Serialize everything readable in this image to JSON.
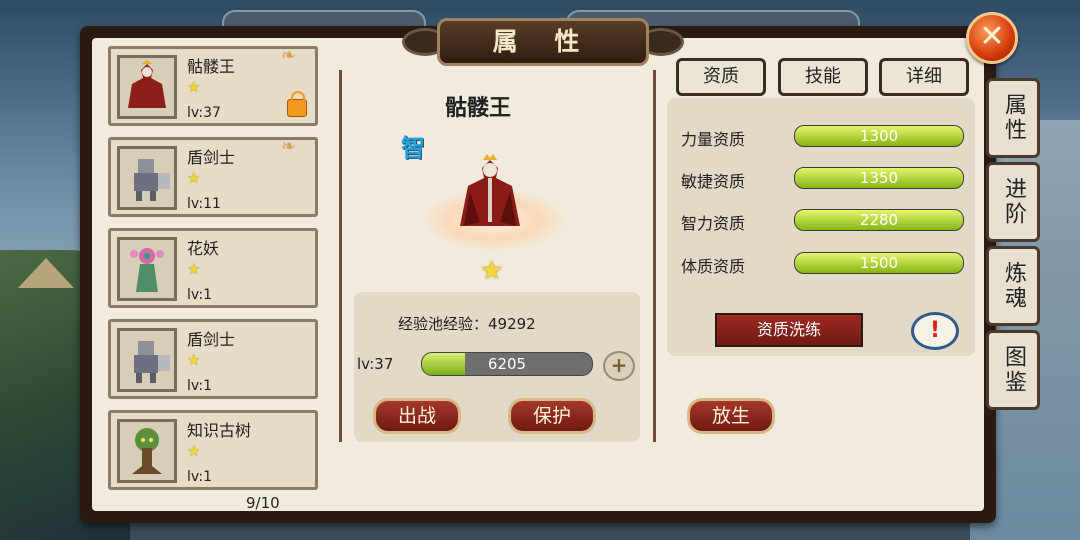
{
  "title": "属 性",
  "close_icon": "✕",
  "heroes": [
    {
      "name": "骷髅王",
      "level": "lv:37",
      "star": "★",
      "locked": true,
      "portrait": "skeleton-king"
    },
    {
      "name": "盾剑士",
      "level": "lv:11",
      "star": "★",
      "locked": false,
      "portrait": "shield-swordsman"
    },
    {
      "name": "花妖",
      "level": "lv:1",
      "star": "★",
      "locked": false,
      "portrait": "flower-demon"
    },
    {
      "name": "盾剑士",
      "level": "lv:1",
      "star": "★",
      "locked": false,
      "portrait": "shield-swordsman"
    },
    {
      "name": "知识古树",
      "level": "lv:1",
      "star": "★",
      "locked": false,
      "portrait": "knowledge-tree"
    }
  ],
  "pager": "9/10",
  "detail": {
    "name": "骷髅王",
    "attr_badge": "智",
    "star": "★",
    "exp_pool": "经验池经验：49292",
    "level": "lv:37",
    "exp_value": "6205",
    "exp_progress": 0.25,
    "plus": "+",
    "buttons": {
      "deploy": "出战",
      "protect": "保护",
      "release": "放生"
    }
  },
  "tabs": [
    "资质",
    "技能",
    "详细"
  ],
  "aptitudes": [
    {
      "label": "力量资质",
      "value": "1300"
    },
    {
      "label": "敏捷资质",
      "value": "1350"
    },
    {
      "label": "智力资质",
      "value": "2280"
    },
    {
      "label": "体质资质",
      "value": "1500"
    }
  ],
  "wash_button": "资质洗练",
  "info_icon": "!",
  "side_tabs": [
    "属性",
    "进阶",
    "炼魂",
    "图鉴"
  ],
  "colors": {
    "accent_red": "#8c2419",
    "bar_green": "#88b515",
    "panel_bg": "#f1ebdd"
  }
}
